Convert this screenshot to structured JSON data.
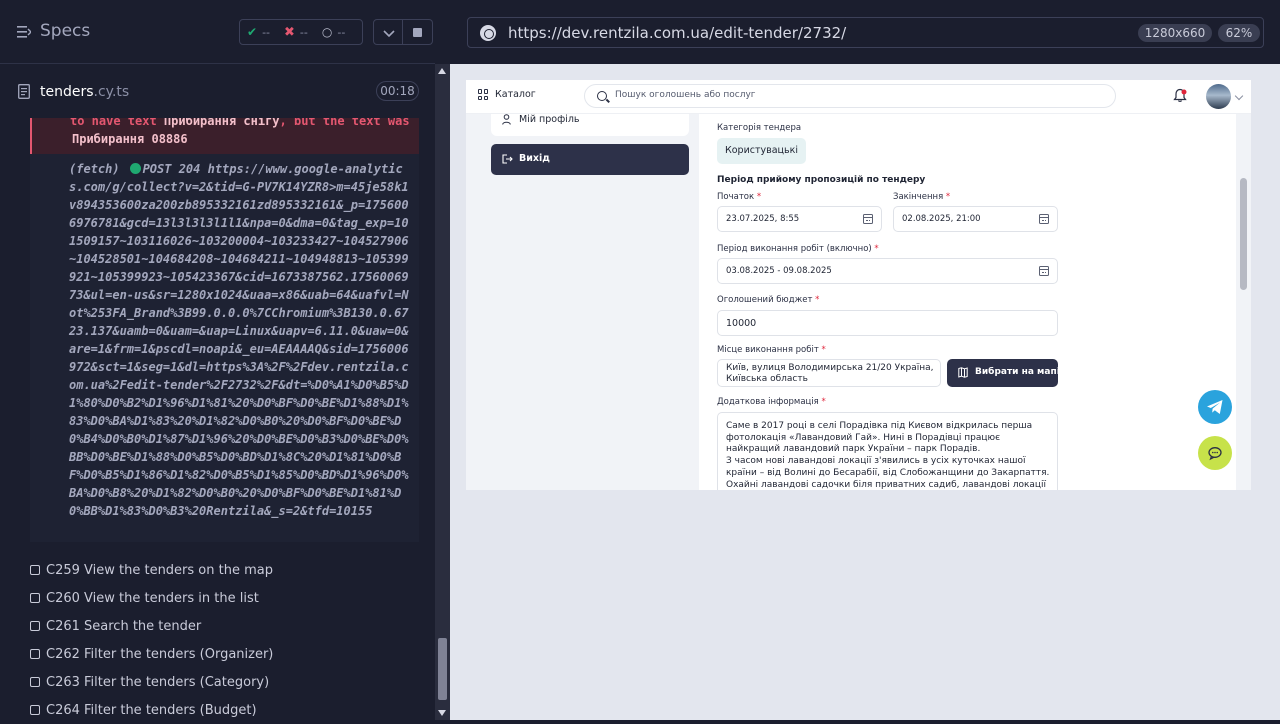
{
  "runner": {
    "specs_title": "Specs",
    "stats": {
      "passed": "--",
      "failed": "--",
      "pending": "--"
    },
    "file": {
      "name": "tenders",
      "ext": ".cy.ts",
      "duration": "00:18"
    },
    "error": {
      "line1_pre": "to have text ",
      "line1_hl": "Прибирання снігу",
      "line1_post": ", but the text was",
      "line2": "Прибирання 08886"
    },
    "log": {
      "prefix": "(fetch)",
      "method_status": "POST 204",
      "url": "https://www.google-analytics.com/g/collect?v=2&tid=G-PV7K14YZR8>m=45je58k1v894353600za200zb895332161zd895332161&_p=1756006976781&gcd=13l3l3l3l1l1&npa=0&dma=0&tag_exp=101509157~103116026~103200004~103233427~104527906~104528501~104684208~104684211~104948813~105399921~105399923~105423367&cid=1673387562.1756006973&ul=en-us&sr=1280x1024&uaa=x86&uab=64&uafvl=Not%253FA_Brand%3B99.0.0.0%7CChromium%3B130.0.6723.137&uamb=0&uam=&uap=Linux&uapv=6.11.0&uaw=0&are=1&frm=1&pscdl=noapi&_eu=AEAAAAQ&sid=1756006972&sct=1&seg=1&dl=https%3A%2F%2Fdev.rentzila.com.ua%2Fedit-tender%2F2732%2F&dt=%D0%A1%D0%B5%D1%80%D0%B2%D1%96%D1%81%20%D0%BF%D0%BE%D1%88%D1%83%D0%BA%D1%83%20%D1%82%D0%B0%20%D0%BF%D0%BE%D0%B4%D0%B0%D1%87%D1%96%20%D0%BE%D0%B3%D0%BE%D0%BB%D0%BE%D1%88%D0%B5%D0%BD%D1%8C%20%D1%81%D0%BF%D0%B5%D1%86%D1%82%D0%B5%D1%85%D0%BD%D1%96%D0%BA%D0%B8%20%D1%82%D0%B0%20%D0%BF%D0%BE%D1%81%D0%BB%D1%83%D0%B3%20Rentzila&_s=2&tfd=10155"
    },
    "tests": [
      "C259 View the tenders on the map",
      "C260 View the tenders in the list",
      "C261 Search the tender",
      "C262 Filter the tenders (Organizer)",
      "C263 Filter the tenders (Category)",
      "C264 Filter the tenders (Budget)"
    ]
  },
  "browser": {
    "url": "https://dev.rentzila.com.ua/edit-tender/2732/",
    "viewport": "1280x660",
    "zoom": "62%"
  },
  "app": {
    "header": {
      "catalog_label": "Каталог",
      "search_placeholder": "Пошук оголошень або послуг"
    },
    "sidebar": {
      "profile_label": "Мій профіль",
      "logout_label": "Вихід"
    },
    "form": {
      "category_label": "Категорія тендера",
      "category_value": "Користувацькі",
      "period_title": "Період прийому пропозицій по тендеру",
      "start_label": "Початок",
      "start_value": "23.07.2025, 8:55",
      "end_label": "Закінчення",
      "end_value": "02.08.2025, 21:00",
      "work_period_label": "Період виконання робіт (включно)",
      "work_period_value": "03.08.2025 - 09.08.2025",
      "budget_label": "Оголошений бюджет",
      "budget_value": "10000",
      "location_label": "Місце виконання робіт",
      "location_value": "Київ, вулиця Володимирська 21/20 Україна, Київська область",
      "map_button": "Вибрати на мапі",
      "info_label": "Додаткова інформація",
      "info_value": "Саме в 2017 році в селі Порадівка під Києвом відкрилась перша фотолокація «Лавандовий Гай». Нині в Порадівці працює найкращий лавандовий парк України – парк Порадів.\nЗ часом нові лавандові локації з'явились в усіх куточках нашої країни – від Волині до Бесарабії, від Слобожанщини до Закарпаття. Охайні лавандові садочки біля приватних садиб, лавандові локації просто"
    }
  },
  "colors": {
    "runner_bg": "#1b1e2e",
    "passed": "#1fa971",
    "failed": "#e45770",
    "primary_button": "#2d3149",
    "badge_bg": "#e6f2f3",
    "telegram": "#2aa3dd",
    "chat": "#c7e24a"
  },
  "icons": [
    "menu-icon",
    "check-icon",
    "x-icon",
    "spinner-icon",
    "chevron-down-icon",
    "stop-icon",
    "document-icon",
    "globe-icon",
    "grid-icon",
    "search-icon",
    "bell-icon",
    "user-icon",
    "logout-icon",
    "map-icon",
    "calendar-icon",
    "telegram-icon",
    "chat-icon"
  ]
}
